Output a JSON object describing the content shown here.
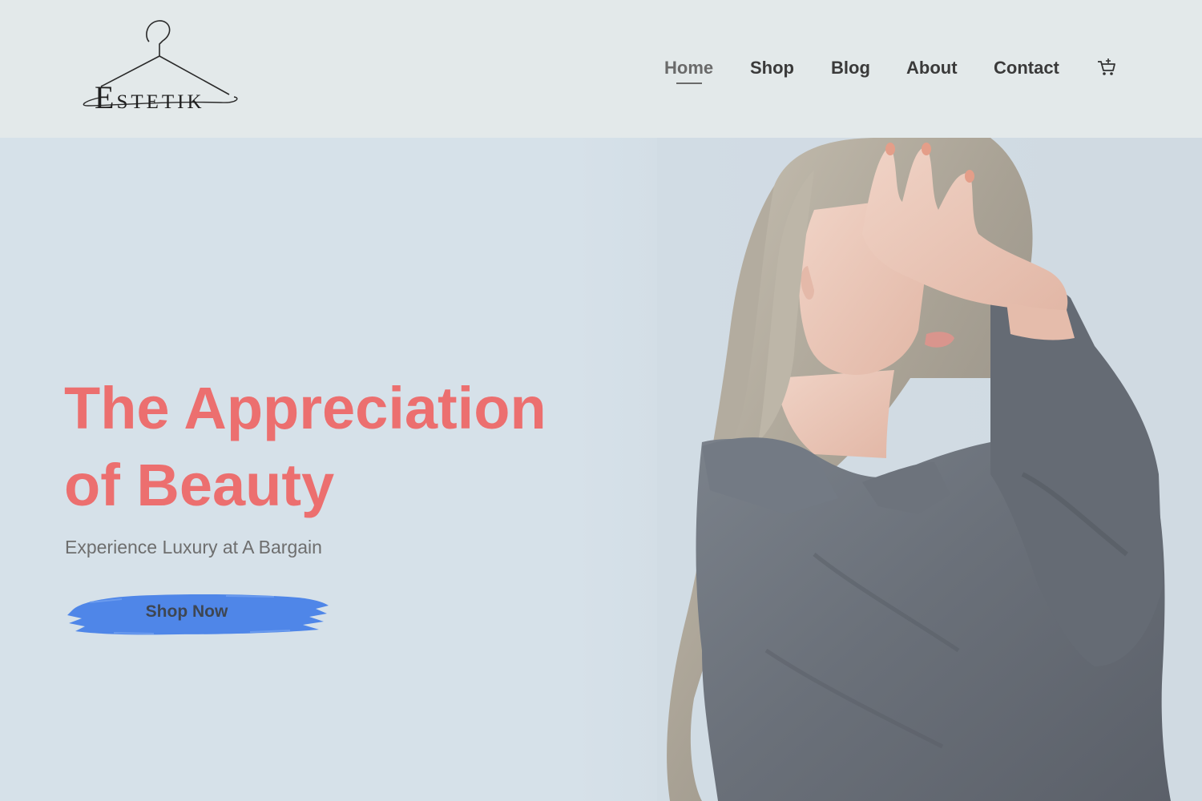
{
  "brand": {
    "logo_first_letter": "E",
    "logo_rest": "STETIK"
  },
  "nav": {
    "items": [
      {
        "label": "Home",
        "active": true
      },
      {
        "label": "Shop",
        "active": false
      },
      {
        "label": "Blog",
        "active": false
      },
      {
        "label": "About",
        "active": false
      },
      {
        "label": "Contact",
        "active": false
      }
    ],
    "cart_icon": "cart-icon"
  },
  "hero": {
    "title_line1": "The Appreciation",
    "title_line2": "of Beauty",
    "subtitle": "Experience Luxury at A Bargain",
    "cta_label": "Shop Now"
  },
  "colors": {
    "header_bg": "#e3e9ea",
    "hero_bg": "#d6e1e9",
    "title": "#ec6f6f",
    "cta_brush": "#4f86e8",
    "nav_text": "#3a3a3a"
  }
}
